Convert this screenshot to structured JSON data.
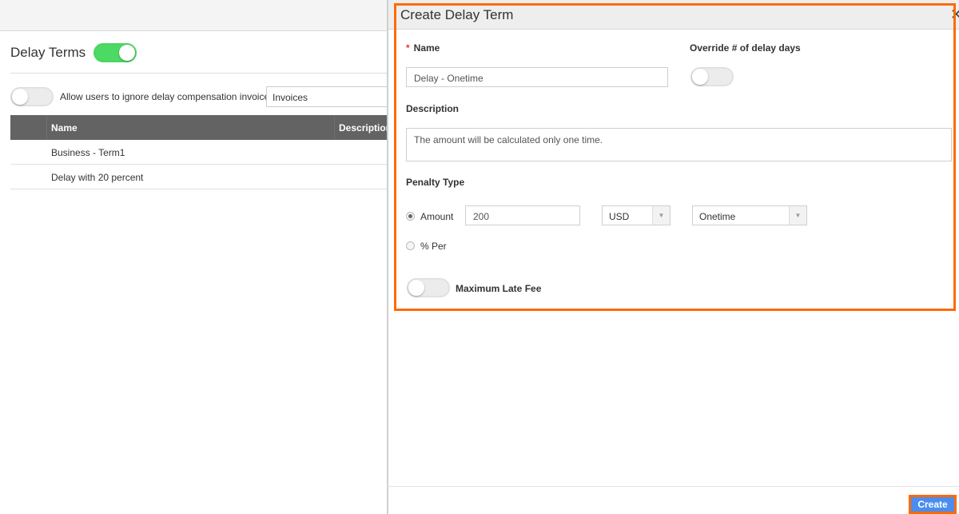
{
  "page": {
    "title": "Delay Terms",
    "title_toggle_on": true,
    "ignore_toggle_on": false,
    "ignore_label": "Allow users to ignore delay compensation invoices",
    "invoice_select_value": "Invoices",
    "grid": {
      "columns": [
        "Name",
        "Description"
      ],
      "rows": [
        {
          "name": "Business - Term1"
        },
        {
          "name": "Delay with 20 percent"
        }
      ]
    }
  },
  "dialog": {
    "title": "Create Delay Term",
    "close_glyph": "✕",
    "name_label": "Name",
    "required_mark": "*",
    "name_value": "Delay - Onetime",
    "override_label": "Override # of delay days",
    "override_on": false,
    "description_label": "Description",
    "description_value": "The amount will be calculated only one time.",
    "penalty_label": "Penalty Type",
    "penalty_options": [
      {
        "label": "Amount",
        "checked": true
      },
      {
        "label": "% Per",
        "checked": false
      }
    ],
    "amount_value": "200",
    "currency_value": "USD",
    "frequency_value": "Onetime",
    "arrow_glyph": "▼",
    "max_late_fee_label": "Maximum Late Fee",
    "max_late_fee_on": false,
    "create_label": "Create"
  },
  "colors": {
    "highlight": "#ff6a00",
    "toggle_on": "#4cd964",
    "primary_button": "#4a8df0",
    "grid_header": "#636363"
  }
}
